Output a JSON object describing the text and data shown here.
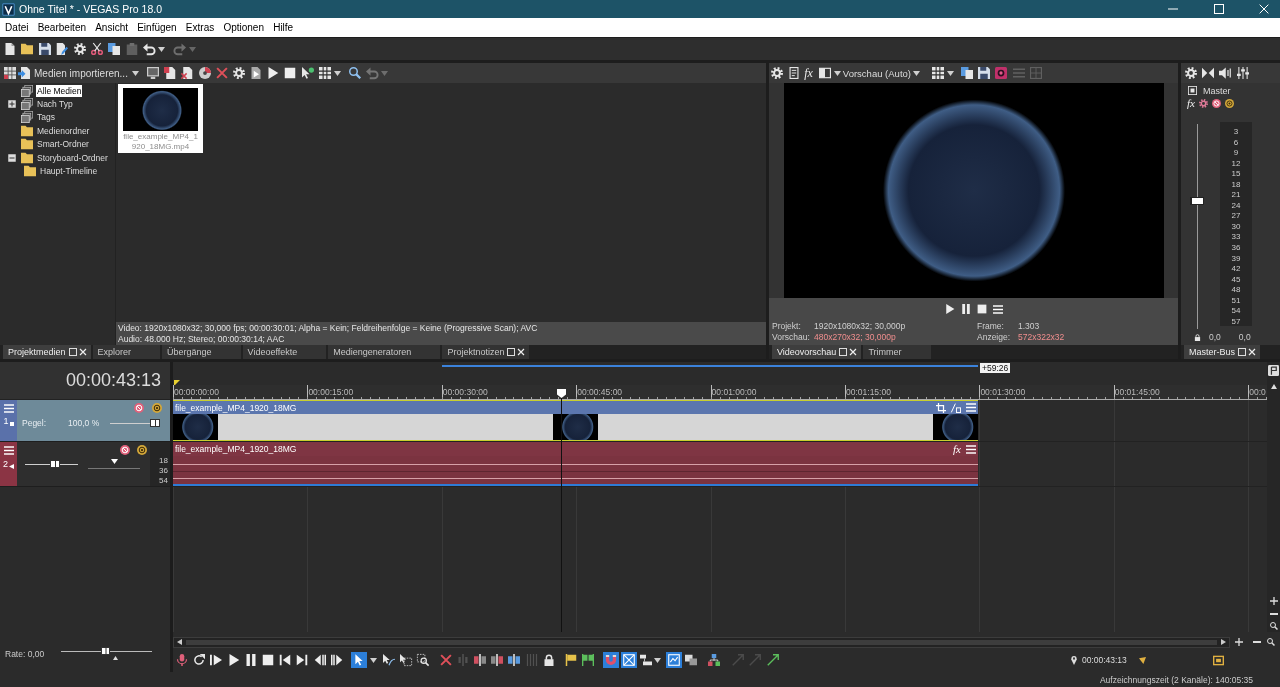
{
  "window": {
    "title": "Ohne Titel * - VEGAS Pro 18.0"
  },
  "menu": [
    "Datei",
    "Bearbeiten",
    "Ansicht",
    "Einfügen",
    "Extras",
    "Optionen",
    "Hilfe"
  ],
  "main_toolbar": [
    {
      "disabled": false
    },
    {
      "disabled": false
    },
    {
      "disabled": false
    },
    {
      "disabled": false
    },
    {
      "disabled": false
    },
    {
      "disabled": false
    },
    {
      "disabled": false
    },
    {
      "disabled": true
    },
    {
      "disabled": false
    },
    {
      "disabled": false
    },
    {
      "disabled": true
    },
    {
      "disabled": true
    }
  ],
  "media_panel": {
    "import_button": "Medien importieren...",
    "toolbar": [
      {
        "disabled": false
      },
      {
        "disabled": false
      },
      {
        "disabled": false
      },
      {
        "disabled": false
      },
      {
        "disabled": false
      },
      {
        "disabled": false
      },
      {
        "disabled": false
      },
      {
        "disabled": false
      },
      {
        "disabled": false
      },
      {
        "disabled": false
      },
      {
        "disabled": false
      },
      {
        "disabled": false
      },
      {
        "disabled": false
      },
      {
        "disabled": false
      },
      {
        "disabled": true
      },
      {
        "disabled": true
      }
    ],
    "tree": [
      {
        "label": "Alle Medien",
        "kind": "collection",
        "selected": true
      },
      {
        "label": "Nach Typ",
        "kind": "collection",
        "selected": false,
        "expanded": false
      },
      {
        "label": "Tags",
        "kind": "collection",
        "selected": false
      },
      {
        "label": "Medienordner",
        "kind": "folder",
        "selected": false
      },
      {
        "label": "Smart-Ordner",
        "kind": "folder",
        "selected": false
      },
      {
        "label": "Storyboard-Ordner",
        "kind": "folder",
        "selected": false,
        "expanded": true,
        "children": [
          {
            "label": "Haupt-Timeline",
            "kind": "folder",
            "selected": false
          }
        ]
      }
    ],
    "media": [
      {
        "name": "file_example_MP4_1920_18MG.mp4",
        "selected": true
      }
    ],
    "info": [
      "Video: 1920x1080x32; 30,000 fps; 00:00:30:01; Alpha = Kein; Feldreihenfolge = Keine (Progressive Scan); AVC",
      "Audio: 48.000 Hz; Stereo; 00:00:30:14; AAC"
    ],
    "tabs": [
      {
        "label": "Projektmedien",
        "selected": true,
        "closable": true
      },
      {
        "label": "Explorer",
        "selected": false,
        "closable": false
      },
      {
        "label": "Übergänge",
        "selected": false,
        "closable": false
      },
      {
        "label": "Videoeffekte",
        "selected": false,
        "closable": false
      },
      {
        "label": "Mediengeneratoren",
        "selected": false,
        "closable": false
      },
      {
        "label": "Projektnotizen",
        "selected": false,
        "closable": true
      }
    ]
  },
  "preview_panel": {
    "toolbar": [
      {
        "disabled": false
      },
      {
        "disabled": false
      },
      {
        "disabled": false
      },
      {
        "disabled": false
      },
      {
        "disabled": false
      },
      {
        "disabled": false
      },
      {
        "disabled": false
      },
      {
        "disabled": false
      },
      {
        "disabled": false
      },
      {
        "disabled": true
      },
      {
        "disabled": true
      }
    ],
    "fx_button": "fx",
    "quality": "Vorschau (Auto)",
    "info": [
      {
        "label": "Projekt:",
        "value": "1920x1080x32; 30,000p",
        "alert": false
      },
      {
        "label": "Frame:",
        "value": "1.303",
        "alert": false
      },
      {
        "label": "Vorschau:",
        "value": "480x270x32; 30,000p",
        "alert": true
      },
      {
        "label": "Anzeige:",
        "value": "572x322x32",
        "alert": true
      }
    ],
    "tabs": [
      {
        "label": "Videovorschau",
        "selected": true,
        "closable": true
      },
      {
        "label": "Trimmer",
        "selected": false,
        "closable": false
      }
    ]
  },
  "master_panel": {
    "title": "Master",
    "fx_button": "fx",
    "fader": {
      "level": 0.63
    },
    "scale": [
      "3",
      "6",
      "9",
      "12",
      "15",
      "18",
      "21",
      "24",
      "27",
      "30",
      "33",
      "36",
      "39",
      "42",
      "45",
      "48",
      "51",
      "54",
      "57"
    ],
    "readings": [
      "0,0",
      "0,0"
    ],
    "tabs": [
      {
        "label": "Master-Bus",
        "selected": true,
        "closable": true
      }
    ]
  },
  "timeline": {
    "time": "00:00:43:13",
    "loop_length": "+59:26",
    "ruler": [
      "00:00:00:00",
      "00:00:15:00",
      "00:00:30:00",
      "00:00:45:00",
      "00:01:00:00",
      "00:01:15:00",
      "00:01:30:00",
      "00:01:45:00",
      "00:0"
    ],
    "tracks": [
      {
        "kind": "video",
        "number": "1",
        "selected": true,
        "fader": {
          "label": "Pegel:",
          "reading": "100,0 %",
          "level": 1
        },
        "clip": {
          "name": "file_example_MP4_1920_18MG"
        }
      },
      {
        "kind": "audio",
        "number": "2",
        "selected": false,
        "fader": {
          "level": 0.58
        },
        "pan": {
          "level": 0.5
        },
        "meter_scale": [
          "18",
          "36",
          "54"
        ],
        "clip": {
          "name": "file_example_MP4_1920_18MG",
          "fx_button": "fx"
        }
      }
    ]
  },
  "transport": {
    "rate": {
      "label": "Rate: 0,00",
      "level": 0.49
    },
    "buttons": [
      {
        "on": false,
        "disabled": false
      },
      {
        "on": false,
        "disabled": false
      },
      {
        "on": false,
        "disabled": false
      },
      {
        "on": false,
        "disabled": false
      },
      {
        "on": false,
        "disabled": false
      },
      {
        "on": false,
        "disabled": false
      },
      {
        "on": false,
        "disabled": false
      },
      {
        "on": false,
        "disabled": false
      },
      {
        "on": false,
        "disabled": false
      },
      {
        "on": false,
        "disabled": false
      },
      {
        "on": true,
        "disabled": false
      },
      {
        "on": false,
        "disabled": false
      },
      {
        "on": false,
        "disabled": false
      },
      {
        "on": false,
        "disabled": false
      },
      {
        "on": false,
        "disabled": false
      },
      {
        "on": false,
        "disabled": false
      },
      {
        "on": false,
        "disabled": true
      },
      {
        "on": false,
        "disabled": false
      },
      {
        "on": false,
        "disabled": false
      },
      {
        "on": false,
        "disabled": false
      },
      {
        "on": false,
        "disabled": true
      },
      {
        "on": false,
        "disabled": false
      },
      {
        "on": false,
        "disabled": false
      },
      {
        "on": false,
        "disabled": false
      },
      {
        "on": true,
        "disabled": false
      },
      {
        "on": true,
        "disabled": false
      },
      {
        "on": false,
        "disabled": false
      },
      {
        "on": false,
        "disabled": false
      },
      {
        "on": true,
        "disabled": false
      },
      {
        "on": false,
        "disabled": false
      },
      {
        "on": false,
        "disabled": false
      },
      {
        "on": false,
        "disabled": true
      },
      {
        "on": false,
        "disabled": true
      },
      {
        "on": false,
        "disabled": false
      }
    ],
    "cursor_time": "00:00:43:13"
  },
  "status_bar": "Aufzeichnungszeit (2 Kanäle): 140:05:35"
}
